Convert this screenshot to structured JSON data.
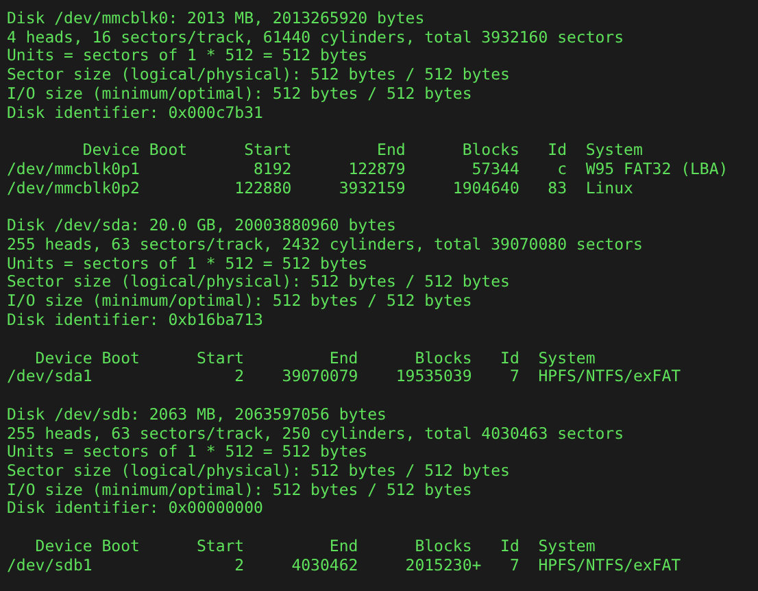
{
  "terminal": {
    "blocks": [
      {
        "info": [
          "Disk /dev/mmcblk0: 2013 MB, 2013265920 bytes",
          "4 heads, 16 sectors/track, 61440 cylinders, total 3932160 sectors",
          "Units = sectors of 1 * 512 = 512 bytes",
          "Sector size (logical/physical): 512 bytes / 512 bytes",
          "I/O size (minimum/optimal): 512 bytes / 512 bytes",
          "Disk identifier: 0x000c7b31"
        ],
        "table": {
          "header": "        Device Boot      Start         End      Blocks   Id  System",
          "rows": [
            "/dev/mmcblk0p1            8192      122879       57344    c  W95 FAT32 (LBA)",
            "/dev/mmcblk0p2          122880     3932159     1904640   83  Linux"
          ]
        }
      },
      {
        "info": [
          "Disk /dev/sda: 20.0 GB, 20003880960 bytes",
          "255 heads, 63 sectors/track, 2432 cylinders, total 39070080 sectors",
          "Units = sectors of 1 * 512 = 512 bytes",
          "Sector size (logical/physical): 512 bytes / 512 bytes",
          "I/O size (minimum/optimal): 512 bytes / 512 bytes",
          "Disk identifier: 0xb16ba713"
        ],
        "table": {
          "header": "   Device Boot      Start         End      Blocks   Id  System",
          "rows": [
            "/dev/sda1               2    39070079    19535039    7  HPFS/NTFS/exFAT"
          ]
        }
      },
      {
        "info": [
          "Disk /dev/sdb: 2063 MB, 2063597056 bytes",
          "255 heads, 63 sectors/track, 250 cylinders, total 4030463 sectors",
          "Units = sectors of 1 * 512 = 512 bytes",
          "Sector size (logical/physical): 512 bytes / 512 bytes",
          "I/O size (minimum/optimal): 512 bytes / 512 bytes",
          "Disk identifier: 0x00000000"
        ],
        "table": {
          "header": "   Device Boot      Start         End      Blocks   Id  System",
          "rows": [
            "/dev/sdb1               2     4030462     2015230+   7  HPFS/NTFS/exFAT"
          ]
        }
      }
    ]
  }
}
